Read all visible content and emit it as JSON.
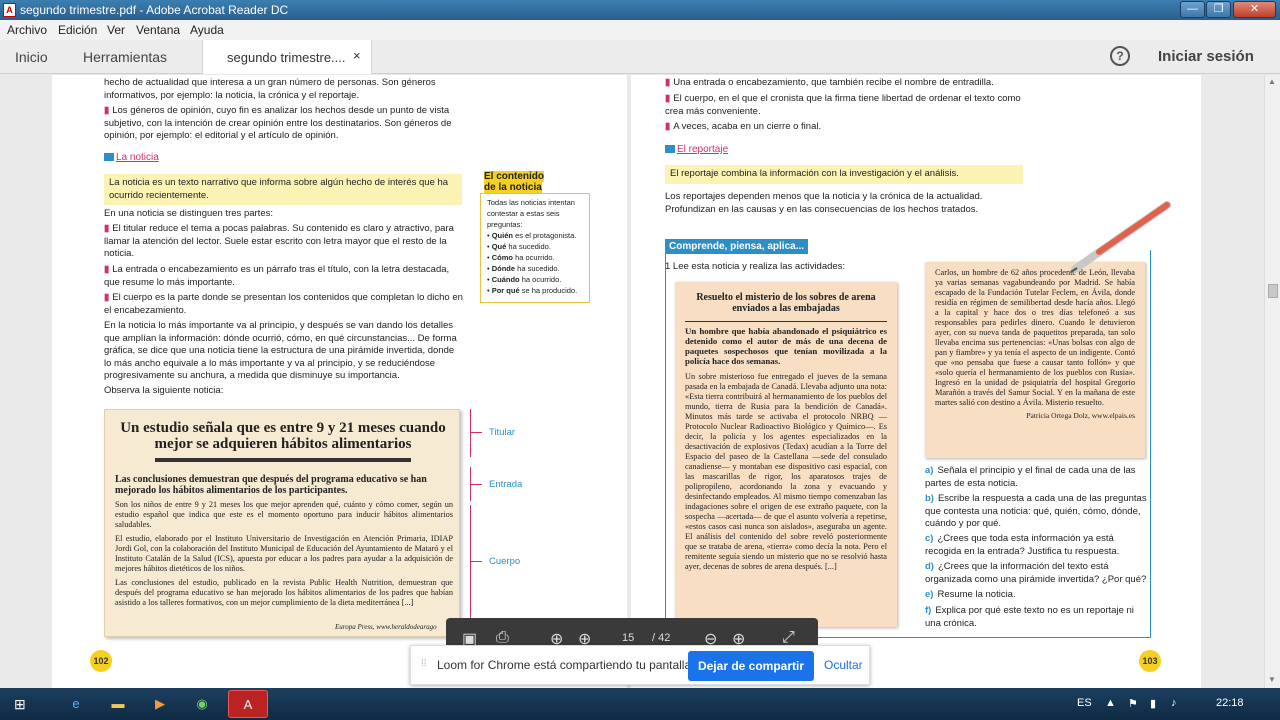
{
  "window": {
    "title": "segundo trimestre.pdf - Adobe Acrobat Reader DC",
    "min": "—",
    "max": "❐",
    "close": "✕"
  },
  "menu": [
    "Archivo",
    "Edición",
    "Ver",
    "Ventana",
    "Ayuda"
  ],
  "tabs": {
    "home": "Inicio",
    "tools": "Herramientas",
    "doc": "segundo trimestre....",
    "doc_close": "×",
    "help": "?",
    "signin": "Iniciar sesión"
  },
  "left": {
    "intro1": "hecho de actualidad que interesa a un gran número de personas. Son géneros informativos, por ejemplo: la noticia, la crónica y el reportaje.",
    "intro2": "Los géneros de opinión, cuyo fin es analizar los hechos desde un punto de vista subjetivo, con la intención de crear opinión entre los destinatarios. Son géneros de opinión, por ejemplo: el editorial y el artículo de opinión.",
    "section": "La noticia",
    "definition": "La noticia es un texto narrativo que informa sobre algún hecho de interés que ha ocurrido recientemente.",
    "parts_intro": "En una noticia se distinguen tres partes:",
    "part1": "El titular reduce el tema a pocas palabras. Su contenido es claro y atractivo, para llamar la atención del lector. Suele estar escrito con letra mayor que el resto de la noticia.",
    "part2": "La entrada o encabezamiento es un párrafo tras el título, con la letra destacada, que resume lo más importante.",
    "part3": "El cuerpo es la parte donde se presentan los contenidos que completan lo dicho en el encabezamiento.",
    "pyramid": "En la noticia lo más importante va al principio, y después se van dando los detalles que amplían la información: dónde ocurrió, cómo, en qué circunstancias... De forma gráfica, se dice que una noticia tiene la estructura de una pirámide invertida, donde lo más ancho equivale a lo más importante y va al principio, y se reduciéndose progresivamente su anchura, a medida que disminuye su importancia.",
    "observe": "Observa la siguiente noticia:",
    "sidebox_title_a": "El contenido",
    "sidebox_title_b": "de la noticia",
    "sidebox_intro": "Todas las noticias intentan contestar a estas seis preguntas:",
    "sidebox_items": [
      {
        "b": "Quién",
        "t": "es el protagonista."
      },
      {
        "b": "Qué",
        "t": "ha sucedido."
      },
      {
        "b": "Cómo",
        "t": "ha ocurrido."
      },
      {
        "b": "Dónde",
        "t": "ha sucedido."
      },
      {
        "b": "Cuándo",
        "t": "ha ocurrido."
      },
      {
        "b": "Por qué",
        "t": "se ha producido."
      }
    ],
    "news_headline": "Un estudio señala que es entre 9 y 21 meses cuando mejor se adquieren hábitos alimentarios",
    "news_lead": "Las conclusiones demuestran que después del programa educativo se han mejorado los hábitos alimentarios de los participantes.",
    "news_body1": "Son los niños de entre 9 y 21 meses los que mejor aprenden qué, cuánto y cómo comer, según un estudio español que indica que este es el momento oportuno para inducir hábitos alimentarios saludables.",
    "news_body2": "El estudio, elaborado por el Instituto Universitario de Investigación en Atención Primaria, IDIAP Jordi Gol, con la colaboración del Instituto Municipal de Educación del Ayuntamiento de Mataró y el Instituto Catalán de la Salud (ICS), apuesta por educar a los padres para ayudar a la adquisición de mejores hábitos dietéticos de los niños.",
    "news_body3": "Las conclusiones del estudio, publicado en la revista Public Health Nutrition, demuestran que después del programa educativo se han mejorado los hábitos alimentarios de los padres que habían asistido a los talleres formativos, con un mejor cumplimiento de la dieta mediterránea [...]",
    "news_source": "Europa Press, www.heraldodearago",
    "label_titular": "Titular",
    "label_entrada": "Entrada",
    "label_cuerpo": "Cuerpo",
    "page_num": "102"
  },
  "right": {
    "b1": "Una entrada o encabezamiento, que también recibe el nombre de entradilla.",
    "b2": "El cuerpo, en el que el cronista que la firma tiene libertad de ordenar el texto como crea más conveniente.",
    "b3": "A veces, acaba en un cierre o final.",
    "section": "El reportaje",
    "definition": "El reportaje combina la información con la investigación y el análisis.",
    "para": "Los reportajes dependen menos que la noticia y la crónica de la actualidad. Profundizan en las causas y en las consecuencias de los hechos tratados.",
    "banner": "Comprende, piensa, aplica...",
    "q1": "1  Lee esta noticia y realiza las actividades:",
    "article_title": "Resuelto el misterio de los sobres de arena enviados a las embajadas",
    "article_lead": "Un hombre que había abandonado el psiquiátrico es detenido como el autor de más de una decena de paquetes sospechosos que tenían movilizada a la policía hace dos semanas.",
    "article_body": "Un sobre misterioso fue entregado el jueves de la semana pasada en la embajada de Canadá. Llevaba adjunto una nota: «Esta tierra contribuirá al hermanamiento de los pueblos del mundo, tierra de Rusia para la bendición de Canadá». Minutos más tarde se activaba el protocolo NRBQ —Protocolo Nuclear Radioactivo Biológico y Químico—. Es decir, la policía y los agentes especializados en la desactivación de explosivos (Tedax) acudían a la Torre del Espacio del paseo de la Castellana —sede del consulado canadiense— y montaban ese dispositivo casi espacial, con las mascarillas de rigor, los aparatosos trajes de polipropileno, acordonando la zona y evacuando y desinfectando empleados. Al mismo tiempo comenzaban las indagaciones sobre el origen de ese extraño paquete, con la sospecha —acertada— de que el asunto volvería a repetirse, «estos casos casi nunca son aislados», aseguraba un agente. El análisis del contenido del sobre reveló posteriormente que se trataba de arena, «tierra» como decía la nota. Pero el remitente seguía siendo un misterio que no se resolvió hasta ayer, decenas de sobres de arena después. [...]",
    "note_text": "Carlos, un hombre de 62 años procedente de León, llevaba ya varias semanas vagabundeando por Madrid. Se había escapado de la Fundación Tutelar Feclem, en Ávila, donde residía en régimen de semilibertad desde hacía años. Llegó a la capital y hace dos o tres días telefoneó a sus responsables para pedirles dinero. Cuando le detuvieron ayer, con su nueva tanda de paquetitos preparada, tan solo llevaba encima sus pertenencias: «Unas bolsas con algo de pan y fiambre» y ya tenía el aspecto de un indigente. Contó que «no pensaba que fuese a causar tanto follón» y que «solo quería el hermanamiento de los pueblos con Rusia». Ingresó en la unidad de psiquiatría del hospital Gregorio Marañón a través del Samur Social. Y en la mañana de este martes salió con destino a Ávila. Misterio resuelto.",
    "note_sig": "Patricia Ortega Dolz, www.elpais.es",
    "activities": [
      {
        "l": "a)",
        "t": "Señala el principio y el final de cada una de las partes de esta noticia."
      },
      {
        "l": "b)",
        "t": "Escribe la respuesta a cada una de las preguntas que contesta una noticia: qué, quién, cómo, dónde, cuándo y por qué."
      },
      {
        "l": "c)",
        "t": "¿Crees que toda esta información ya está recogida en la entrada? Justifica tu respuesta."
      },
      {
        "l": "d)",
        "t": "¿Crees que la información del texto está organizada como una pirámide invertida? ¿Por qué?"
      },
      {
        "l": "e)",
        "t": "Resume la noticia."
      },
      {
        "l": "f)",
        "t": "Explica por qué este texto no es un reportaje ni una crónica."
      }
    ],
    "page_num": "103"
  },
  "toolbar": {
    "page_current": "15",
    "page_total": "/ 42"
  },
  "share": {
    "message": "Loom for Chrome está compartiendo tu pantalla.",
    "stop": "Dejar de compartir",
    "hide": "Ocultar"
  },
  "taskbar": {
    "lang": "ES",
    "time": "22:18"
  }
}
